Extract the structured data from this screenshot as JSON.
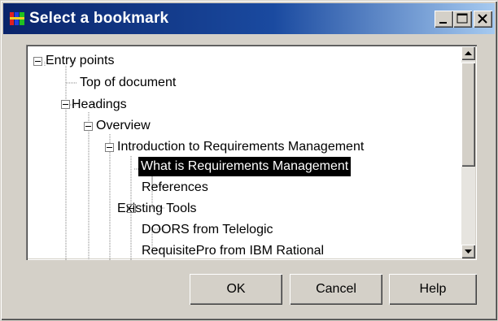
{
  "window": {
    "title": "Select a bookmark"
  },
  "tree": {
    "nodes": [
      {
        "label": "Entry points",
        "expanded": true
      },
      {
        "label": "Top of document"
      },
      {
        "label": "Headings",
        "expanded": true
      },
      {
        "label": "Overview",
        "expanded": true
      },
      {
        "label": "Introduction to Requirements Management",
        "expanded": true
      },
      {
        "label": "What is Requirements Management",
        "selected": true
      },
      {
        "label": "References"
      },
      {
        "label": "Existing Tools",
        "expanded": true
      },
      {
        "label": "DOORS from Telelogic"
      },
      {
        "label": "RequisitePro from IBM Rational"
      }
    ]
  },
  "buttons": {
    "ok": "OK",
    "cancel": "Cancel",
    "help": "Help"
  },
  "icons": {
    "app": "bookmark-app-icon",
    "minimize": "minimize-icon",
    "maximize": "maximize-icon",
    "close": "close-icon",
    "expand": "minus-box-icon",
    "scroll_up": "arrow-up-icon",
    "scroll_down": "arrow-down-icon"
  },
  "colors": {
    "titlebar_start": "#0a246a",
    "titlebar_end": "#a6caf0",
    "face": "#d4d0c8",
    "selection": "#000000"
  }
}
